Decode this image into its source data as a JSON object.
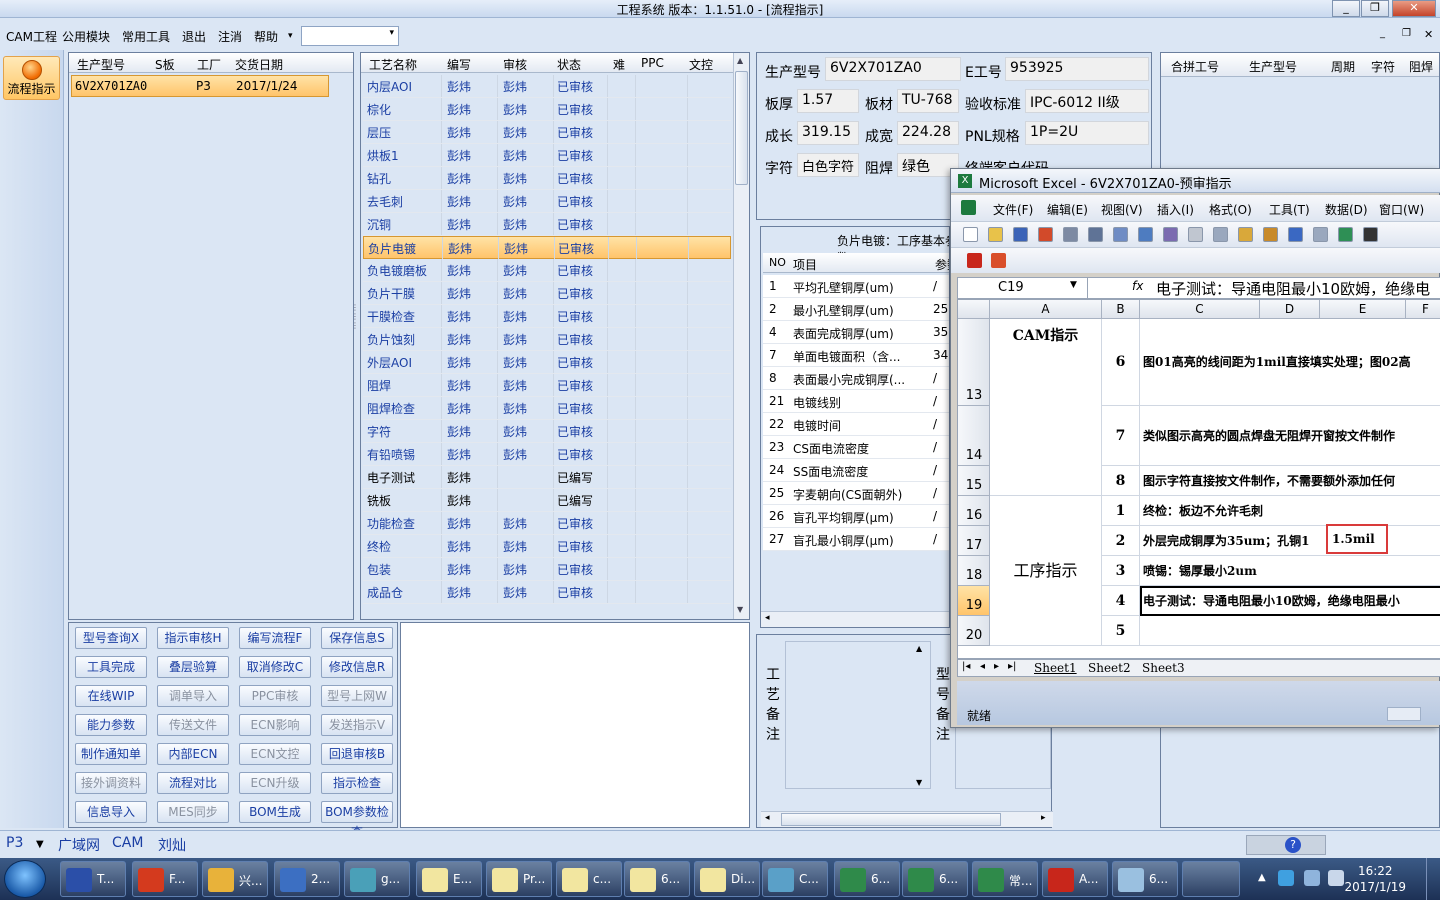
{
  "title_bar": {
    "title": "工程系统   版本：1.1.51.0 - [流程指示]",
    "min": "_",
    "restore": "❐",
    "close": "✕"
  },
  "menu": {
    "items": [
      "CAM工程",
      "公用模块",
      "常用工具",
      "退出",
      "注消",
      "帮助"
    ],
    "help_arrow": "▾",
    "combo_value": ""
  },
  "nav": {
    "flow_label": "流程指示"
  },
  "product_grid": {
    "headers": [
      "生产型号",
      "S板",
      "工厂",
      "交货日期"
    ],
    "rows": [
      {
        "model": "6V2X701ZA0",
        "s": "",
        "factory": "P3",
        "date": "2017/1/24"
      }
    ]
  },
  "process_grid": {
    "headers": [
      "工艺名称",
      "编写",
      "审核",
      "状态",
      "难",
      "PPC",
      "文控"
    ],
    "rows": [
      {
        "name": "内层AOI",
        "writer": "彭炜",
        "reviewer": "彭炜",
        "status": "已审核"
      },
      {
        "name": "棕化",
        "writer": "彭炜",
        "reviewer": "彭炜",
        "status": "已审核"
      },
      {
        "name": "层压",
        "writer": "彭炜",
        "reviewer": "彭炜",
        "status": "已审核"
      },
      {
        "name": "烘板1",
        "writer": "彭炜",
        "reviewer": "彭炜",
        "status": "已审核"
      },
      {
        "name": "钻孔",
        "writer": "彭炜",
        "reviewer": "彭炜",
        "status": "已审核"
      },
      {
        "name": "去毛刺",
        "writer": "彭炜",
        "reviewer": "彭炜",
        "status": "已审核"
      },
      {
        "name": "沉铜",
        "writer": "彭炜",
        "reviewer": "彭炜",
        "status": "已审核"
      },
      {
        "name": "负片电镀",
        "writer": "彭炜",
        "reviewer": "彭炜",
        "status": "已审核"
      },
      {
        "name": "负电镀磨板",
        "writer": "彭炜",
        "reviewer": "彭炜",
        "status": "已审核"
      },
      {
        "name": "负片干膜",
        "writer": "彭炜",
        "reviewer": "彭炜",
        "status": "已审核"
      },
      {
        "name": "干膜检查",
        "writer": "彭炜",
        "reviewer": "彭炜",
        "status": "已审核"
      },
      {
        "name": "负片蚀刻",
        "writer": "彭炜",
        "reviewer": "彭炜",
        "status": "已审核"
      },
      {
        "name": "外层AOI",
        "writer": "彭炜",
        "reviewer": "彭炜",
        "status": "已审核"
      },
      {
        "name": "阻焊",
        "writer": "彭炜",
        "reviewer": "彭炜",
        "status": "已审核"
      },
      {
        "name": "阻焊检查",
        "writer": "彭炜",
        "reviewer": "彭炜",
        "status": "已审核"
      },
      {
        "name": "字符",
        "writer": "彭炜",
        "reviewer": "彭炜",
        "status": "已审核"
      },
      {
        "name": "有铅喷锡",
        "writer": "彭炜",
        "reviewer": "彭炜",
        "status": "已审核"
      },
      {
        "name": "电子测试",
        "writer": "彭炜",
        "reviewer": "",
        "status": "已编写"
      },
      {
        "name": "铣板",
        "writer": "彭炜",
        "reviewer": "",
        "status": "已编写"
      },
      {
        "name": "功能检查",
        "writer": "彭炜",
        "reviewer": "彭炜",
        "status": "已审核"
      },
      {
        "name": "终检",
        "writer": "彭炜",
        "reviewer": "彭炜",
        "status": "已审核"
      },
      {
        "name": "包装",
        "writer": "彭炜",
        "reviewer": "彭炜",
        "status": "已审核"
      },
      {
        "name": "成品仓",
        "writer": "彭炜",
        "reviewer": "彭炜",
        "status": "已审核"
      }
    ]
  },
  "buttons": [
    [
      "型号查询X",
      "指示审核H",
      "编写流程F",
      "保存信息S"
    ],
    [
      "工具完成",
      "叠层验算",
      "取消修改C",
      "修改信息R"
    ],
    [
      "在线WIP",
      "调单导入",
      "PPC审核",
      "型号上网W"
    ],
    [
      "能力参数",
      "传送文件",
      "ECN影响",
      "发送指示V"
    ],
    [
      "制作通知单",
      "内部ECN",
      "ECN文控",
      "回退审核B"
    ],
    [
      "接外调资料",
      "流程对比",
      "ECN升级",
      "指示检查"
    ],
    [
      "信息导入",
      "MES同步",
      "BOM生成",
      "BOM参数检查"
    ]
  ],
  "info": {
    "model_label": "生产型号",
    "model": "6V2X701ZA0",
    "eno_label": "E工号",
    "eno": "953925",
    "thick_label": "板厚",
    "thick": "1.57",
    "mat_label": "板材",
    "mat": "TU-768",
    "std_label": "验收标准",
    "std": "IPC-6012 II级",
    "len_label": "成长",
    "len": "319.15",
    "wid_label": "成宽",
    "wid": "224.28",
    "pnl_label": "PNL规格",
    "pnl": "1P=2U",
    "char_label": "字符",
    "char": "白色字符",
    "mask_label": "阻焊",
    "mask": "绿色",
    "cust_label": "终端客户代码"
  },
  "merge_grid": {
    "headers": [
      "合拼工号",
      "生产型号",
      "周期",
      "字符",
      "阻焊"
    ]
  },
  "params": {
    "title": "负片电镀：工序基本参数",
    "headers": [
      "NO",
      "项目",
      "参数"
    ],
    "rows": [
      {
        "no": "1",
        "item": "平均孔壁铜厚(um)",
        "val": "/"
      },
      {
        "no": "2",
        "item": "最小孔壁铜厚(um)",
        "val": "25."
      },
      {
        "no": "4",
        "item": "表面完成铜厚(um)",
        "val": "35"
      },
      {
        "no": "7",
        "item": "单面电镀面积（含...",
        "val": "347"
      },
      {
        "no": "8",
        "item": "表面最小完成铜厚(...",
        "val": "/"
      },
      {
        "no": "21",
        "item": "电镀线别",
        "val": "/"
      },
      {
        "no": "22",
        "item": "电镀时间",
        "val": "/"
      },
      {
        "no": "23",
        "item": "CS面电流密度",
        "val": "/"
      },
      {
        "no": "24",
        "item": "SS面电流密度",
        "val": "/"
      },
      {
        "no": "25",
        "item": "字麦朝向(CS面朝外)",
        "val": "/"
      },
      {
        "no": "26",
        "item": "盲孔平均铜厚(μm)",
        "val": "/"
      },
      {
        "no": "27",
        "item": "盲孔最小铜厚(μm)",
        "val": "/"
      }
    ]
  },
  "remark": {
    "label1": "工艺备注",
    "label2": "型号备注"
  },
  "excel": {
    "title": "Microsoft Excel - 6V2X701ZA0-预审指示",
    "menus": [
      "文件(F)",
      "编辑(E)",
      "视图(V)",
      "插入(I)",
      "格式(O)",
      "工具(T)",
      "数据(D)",
      "窗口(W)"
    ],
    "namebox": "C19",
    "fx": "fx",
    "formula": "电子测试：导通电阻最小10欧姆，绝缘电",
    "columns": [
      "A",
      "B",
      "C",
      "D",
      "E",
      "F"
    ],
    "rows": [
      {
        "num": "13",
        "b": "6",
        "c": "图01高亮的线间距为1mil直接填实处理；图02高"
      },
      {
        "num": "14",
        "b": "7",
        "c": "类似图示高亮的圆点焊盘无阻焊开窗按文件制作"
      },
      {
        "num": "15",
        "b": "8",
        "c": "图示字符直接按文件制作，不需要额外添加任何"
      },
      {
        "num": "16",
        "b": "1",
        "c": "终检：板边不允许毛刺"
      },
      {
        "num": "17",
        "b": "2",
        "c": "外层完成铜厚为35um；孔铜1"
      },
      {
        "num": "18",
        "b": "3",
        "c": "喷锡：锡厚最小2um"
      },
      {
        "num": "19",
        "b": "4",
        "c": "电子测试：导通电阻最小10欧姆，绝缘电阻最小"
      },
      {
        "num": "20",
        "b": "5",
        "c": ""
      }
    ],
    "cam_label": "CAM指示",
    "proc_label": "工序指示",
    "highlight": "1.5mil",
    "sheets": [
      "Sheet1",
      "Sheet2",
      "Sheet3"
    ],
    "status": "就绪"
  },
  "app_status": {
    "factory": "P3",
    "tabs": [
      "广域网",
      "CAM",
      "刘灿"
    ]
  },
  "taskbar": {
    "tasks": [
      "T...",
      "F...",
      "兴...",
      "2...",
      "g...",
      "E...",
      "Pr...",
      "c...",
      "6...",
      "Di...",
      "C...",
      "6...",
      "6...",
      "常...",
      "A...",
      "6..."
    ],
    "time": "16:22",
    "date": "2017/1/19"
  }
}
